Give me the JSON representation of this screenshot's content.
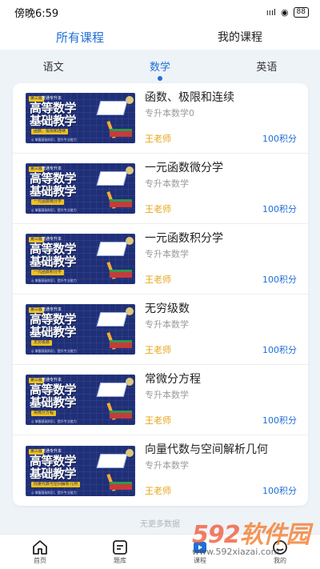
{
  "status_bar": {
    "time": "傍晚6:59",
    "signal": "ıııl",
    "wifi": "◉",
    "battery": "88"
  },
  "top_tabs": [
    {
      "label": "所有课程",
      "active": true
    },
    {
      "label": "我的课程",
      "active": false
    }
  ],
  "sub_tabs": [
    {
      "label": "语文",
      "active": false
    },
    {
      "label": "数学",
      "active": true
    },
    {
      "label": "英语",
      "active": false
    }
  ],
  "thumbnail": {
    "badge": "第三版",
    "tag": "普通专升本",
    "line1": "高等数学",
    "line2": "基础教学",
    "footer": "◎ 掌握基础知识，提升专业能力"
  },
  "courses": [
    {
      "title": "函数、极限和连续",
      "subtitle": "专升本数学0",
      "teacher": "王老师",
      "price": "100积分",
      "chip": "函数、极限和连续"
    },
    {
      "title": "一元函数微分学",
      "subtitle": "专升本数学",
      "teacher": "王老师",
      "price": "100积分",
      "chip": "一元函数微分学"
    },
    {
      "title": "一元函数积分学",
      "subtitle": "专升本数学",
      "teacher": "王老师",
      "price": "100积分",
      "chip": "一元函数积分学"
    },
    {
      "title": "无穷级数",
      "subtitle": "专升本数学",
      "teacher": "王老师",
      "price": "100积分",
      "chip": "无穷级数"
    },
    {
      "title": "常微分方程",
      "subtitle": "专升本数学",
      "teacher": "王老师",
      "price": "100积分",
      "chip": "常微分方程"
    },
    {
      "title": "向量代数与空间解析几何",
      "subtitle": "专升本数学",
      "teacher": "王老师",
      "price": "100积分",
      "chip": "向量代数与空间解析几何"
    }
  ],
  "list_footer": "无更多数据",
  "bottom_nav": [
    {
      "label": "首页",
      "icon": "home-icon"
    },
    {
      "label": "题库",
      "icon": "question-bank-icon"
    },
    {
      "label": "课程",
      "icon": "course-icon"
    },
    {
      "label": "我的",
      "icon": "profile-icon"
    }
  ],
  "watermark": {
    "brand_num": "592",
    "brand_text": "软件园",
    "url": "www.592xiazai.com"
  },
  "colors": {
    "accent": "#1f6fd6",
    "teacher": "#e6a617",
    "thumb_bg": "#1f2f78"
  }
}
